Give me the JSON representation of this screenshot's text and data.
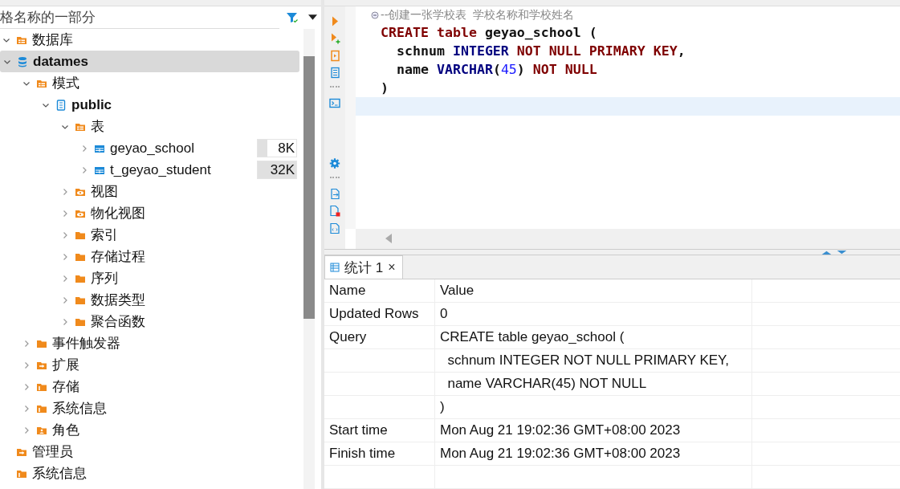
{
  "navigator": {
    "search": {
      "placeholder": "格名称的一部分"
    },
    "tree": [
      {
        "label": "数据库",
        "kind": "db-folder",
        "selected": false,
        "expanded": true,
        "children": [
          {
            "label": "datames",
            "kind": "database",
            "selected": true,
            "expanded": true,
            "children": [
              {
                "label": "模式",
                "kind": "schema-folder",
                "selected": false,
                "expanded": true,
                "children": [
                  {
                    "label": "public",
                    "kind": "schema",
                    "selected": false,
                    "expanded": true,
                    "children": [
                      {
                        "label": "表",
                        "kind": "table-folder",
                        "selected": false,
                        "expanded": true,
                        "children": [
                          {
                            "label": "geyao_school",
                            "kind": "table",
                            "selected": false,
                            "expanded": false,
                            "size": "8K",
                            "level": 0.25
                          },
                          {
                            "label": "t_geyao_student",
                            "kind": "table",
                            "selected": false,
                            "expanded": false,
                            "size": "32K",
                            "level": 1
                          }
                        ]
                      },
                      {
                        "label": "视图",
                        "kind": "view-folder",
                        "selected": false,
                        "expanded": false
                      },
                      {
                        "label": "物化视图",
                        "kind": "view-folder",
                        "selected": false,
                        "expanded": false
                      },
                      {
                        "label": "索引",
                        "kind": "folder",
                        "selected": false,
                        "expanded": false
                      },
                      {
                        "label": "存储过程",
                        "kind": "folder",
                        "selected": false,
                        "expanded": false
                      },
                      {
                        "label": "序列",
                        "kind": "folder",
                        "selected": false,
                        "expanded": false
                      },
                      {
                        "label": "数据类型",
                        "kind": "folder",
                        "selected": false,
                        "expanded": false
                      },
                      {
                        "label": "聚合函数",
                        "kind": "folder",
                        "selected": false,
                        "expanded": false
                      }
                    ]
                  }
                ]
              },
              {
                "label": "事件触发器",
                "kind": "folder",
                "selected": false,
                "expanded": false
              },
              {
                "label": "扩展",
                "kind": "ext-folder",
                "selected": false,
                "expanded": false
              },
              {
                "label": "存储",
                "kind": "info-folder",
                "selected": false,
                "expanded": false
              },
              {
                "label": "系统信息",
                "kind": "info-folder",
                "selected": false,
                "expanded": false
              },
              {
                "label": "角色",
                "kind": "role-folder",
                "selected": false,
                "expanded": false
              }
            ]
          }
        ]
      },
      {
        "label": "管理员",
        "kind": "ext-folder",
        "selected": false
      },
      {
        "label": "系统信息",
        "kind": "info-folder",
        "selected": false
      }
    ]
  },
  "editor": {
    "comment": "--创建一张学校表  学校名称和学校姓名",
    "lines": [
      [
        {
          "text": "CREATE",
          "kind": "keyword"
        },
        {
          "text": " table",
          "kind": "keyword"
        },
        {
          "text": " geyao_school ("
        }
      ],
      [
        {
          "text": "  schnum "
        },
        {
          "text": "INTEGER",
          "kind": "type"
        },
        {
          "text": " NOT NULL PRIMARY KEY",
          "kind": "keyword"
        },
        {
          "text": ","
        }
      ],
      [
        {
          "text": "  name "
        },
        {
          "text": "VARCHAR",
          "kind": "type"
        },
        {
          "text": "("
        },
        {
          "text": "45",
          "kind": "number"
        },
        {
          "text": ") "
        },
        {
          "text": "NOT NULL",
          "kind": "keyword"
        }
      ],
      [
        {
          "text": ")"
        }
      ]
    ]
  },
  "results": {
    "tabs": [
      {
        "label": "统计 1",
        "selected": true,
        "close": "×"
      }
    ],
    "columns": [
      "Name",
      "Value"
    ],
    "rows": [
      [
        "Updated Rows",
        "0"
      ],
      [
        "Query",
        "CREATE table geyao_school ("
      ],
      [
        "",
        "  schnum INTEGER NOT NULL PRIMARY KEY,"
      ],
      [
        "",
        "  name VARCHAR(45) NOT NULL"
      ],
      [
        "",
        ")"
      ],
      [
        "Start time",
        "Mon Aug 21 19:02:36 GMT+08:00 2023"
      ],
      [
        "Finish time",
        "Mon Aug 21 19:02:36 GMT+08:00 2023"
      ]
    ]
  }
}
